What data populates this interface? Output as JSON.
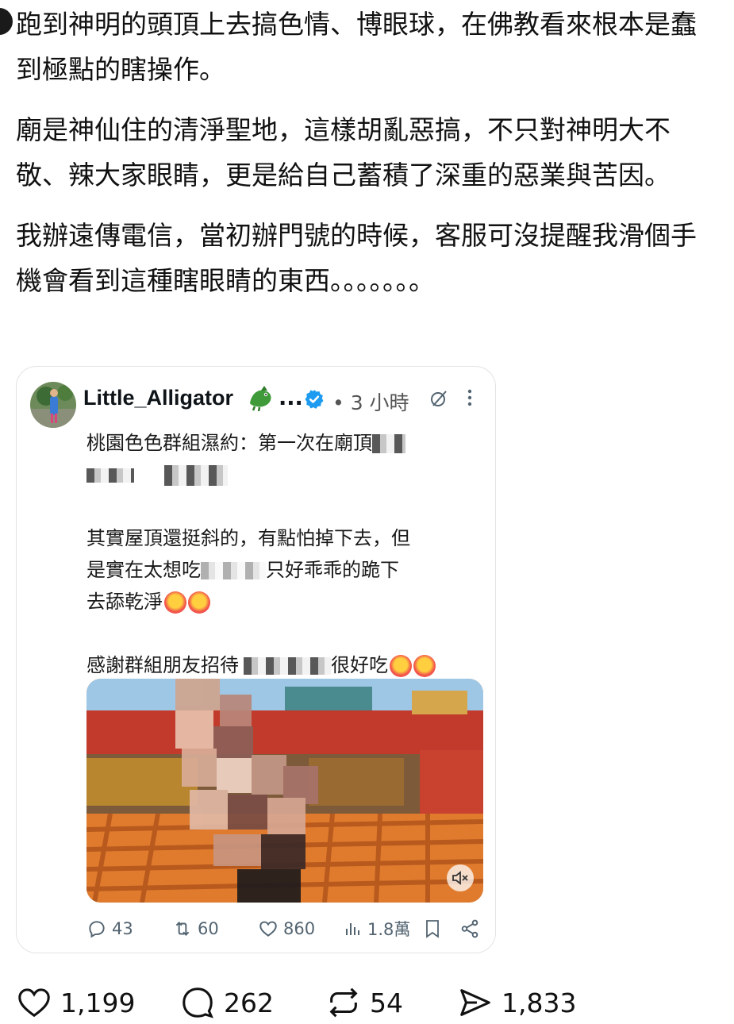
{
  "post": {
    "paragraphs": [
      "跑到神明的頭頂上去搞色情、博眼球，在佛教看來根本是蠢到極點的瞎操作。",
      "廟是神仙住的清淨聖地，這樣胡亂惡搞，不只對神明大不敬、辣大家眼睛，更是給自己蓄積了深重的惡業與苦因。",
      "我辦遠傳電信，當初辦門號的時候，客服可沒提醒我滑個手機會看到這種瞎眼睛的東西。。。。。。。"
    ]
  },
  "embedded": {
    "author": "Little_Alligator",
    "ellipsis": "...",
    "time": "• 3 小時",
    "text": {
      "line1": "桃園色色群組濕約：第一次在廟頂",
      "line3a": "其實屋頂還挺斜的，有點怕掉下去，但",
      "line3b_a": "是實在太想吃",
      "line3b_b": "只好乖乖的跪下",
      "line3c": "去舔乾淨",
      "line4a": "感謝群組朋友招待",
      "line4b": "很好吃"
    },
    "stats": {
      "replies": "43",
      "reposts": "60",
      "likes": "860",
      "views": "1.8萬"
    }
  },
  "actions": {
    "likes": "1,199",
    "comments": "262",
    "reposts": "54",
    "shares": "1,833"
  },
  "colors": {
    "verified": "#1d9bf0",
    "muted": "#536471"
  }
}
